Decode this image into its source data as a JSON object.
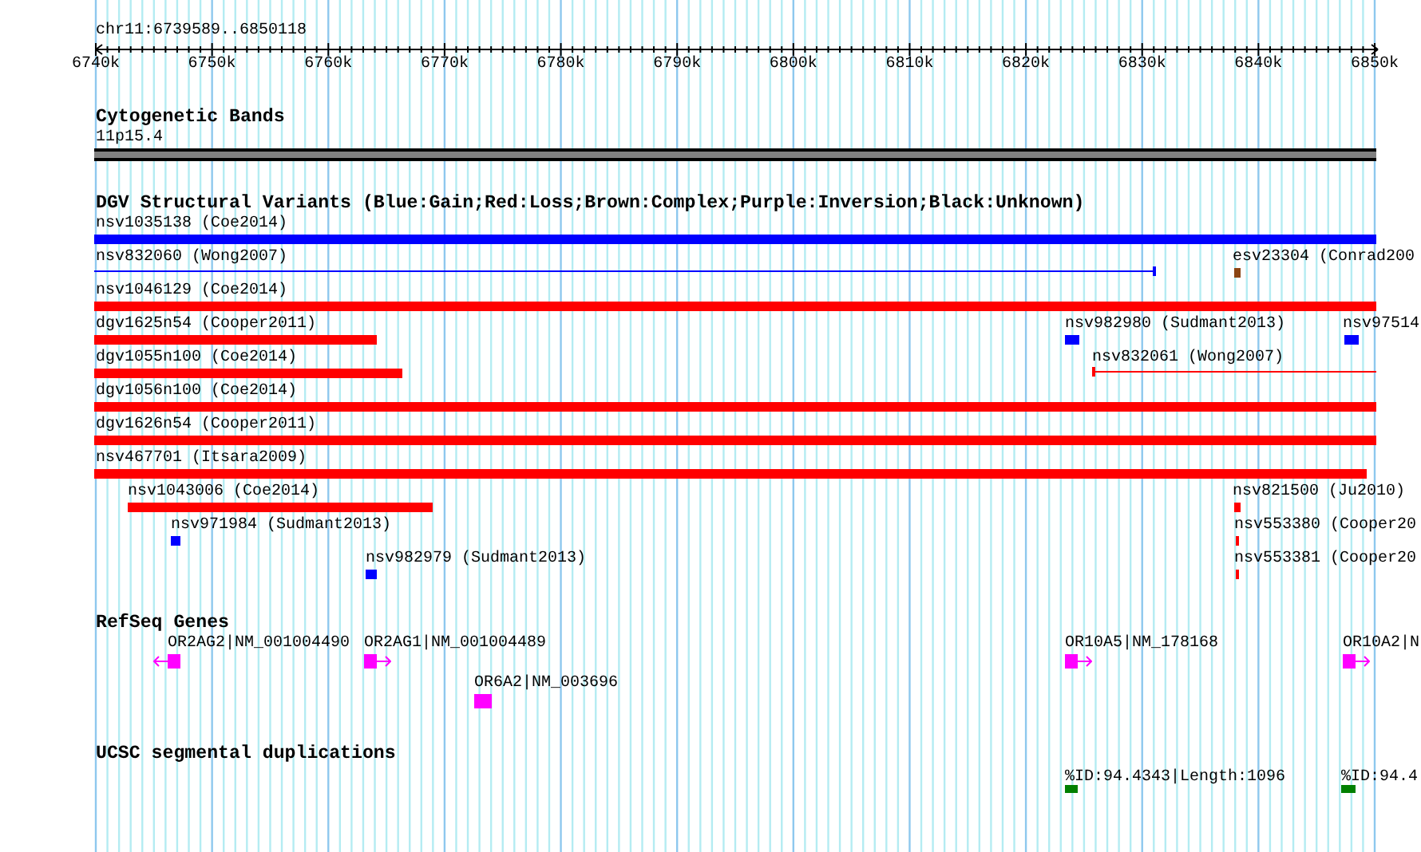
{
  "ruler": {
    "title": "chr11:6739589..6850118",
    "ticks": [
      "6740k",
      "6750k",
      "6760k",
      "6770k",
      "6780k",
      "6790k",
      "6800k",
      "6810k",
      "6820k",
      "6830k",
      "6840k",
      "6850k"
    ]
  },
  "tracks": [
    {
      "title": "Cytogenetic Bands",
      "features": [
        {
          "kind": "band",
          "label": "11p15.4",
          "color": "#808080"
        }
      ]
    },
    {
      "title": "DGV Structural Variants (Blue:Gain;Red:Loss;Brown:Complex;Purple:Inversion;Black:Unknown)",
      "features": [
        {
          "kind": "solid",
          "label": "nsv1035138 (Coe2014)",
          "color": "#0000ff"
        },
        {
          "kind": "line",
          "label": "nsv832060 (Wong2007)",
          "color": "#0000ff"
        },
        {
          "kind": "solid",
          "label": "esv23304 (Conrad200",
          "color": "#8b4513"
        },
        {
          "kind": "solid",
          "label": "nsv1046129 (Coe2014)",
          "color": "#ff0000"
        },
        {
          "kind": "solid",
          "label": "dgv1625n54 (Cooper2011)",
          "color": "#ff0000"
        },
        {
          "kind": "solid",
          "label": "nsv982980 (Sudmant2013)",
          "color": "#0000ff"
        },
        {
          "kind": "solid",
          "label": "nsv97514",
          "color": "#0000ff"
        },
        {
          "kind": "solid",
          "label": "dgv1055n100 (Coe2014)",
          "color": "#ff0000"
        },
        {
          "kind": "line",
          "label": "nsv832061 (Wong2007)",
          "color": "#ff0000"
        },
        {
          "kind": "solid",
          "label": "dgv1056n100 (Coe2014)",
          "color": "#ff0000"
        },
        {
          "kind": "solid",
          "label": "dgv1626n54 (Cooper2011)",
          "color": "#ff0000"
        },
        {
          "kind": "solid",
          "label": "nsv467701 (Itsara2009)",
          "color": "#ff0000"
        },
        {
          "kind": "solid",
          "label": "nsv1043006 (Coe2014)",
          "color": "#ff0000"
        },
        {
          "kind": "solid",
          "label": "nsv821500 (Ju2010)",
          "color": "#ff0000"
        },
        {
          "kind": "solid",
          "label": "nsv971984 (Sudmant2013)",
          "color": "#0000ff"
        },
        {
          "kind": "solid",
          "label": "nsv553380 (Cooper20",
          "color": "#ff0000"
        },
        {
          "kind": "solid",
          "label": "nsv982979 (Sudmant2013)",
          "color": "#0000ff"
        },
        {
          "kind": "solid",
          "label": "nsv553381 (Cooper20",
          "color": "#ff0000"
        }
      ]
    },
    {
      "title": "RefSeq Genes",
      "features": [
        {
          "kind": "reverse",
          "label": "OR2AG2|NM_001004490",
          "color": "#ff00ff"
        },
        {
          "kind": "forward",
          "label": "OR2AG1|NM_001004489",
          "color": "#ff00ff"
        },
        {
          "kind": "plain",
          "label": "OR6A2|NM_003696",
          "color": "#ff00ff"
        },
        {
          "kind": "forward",
          "label": "OR10A5|NM_178168",
          "color": "#ff00ff"
        },
        {
          "kind": "forward",
          "label": "OR10A2|N",
          "color": "#ff00ff"
        }
      ]
    },
    {
      "title": "UCSC segmental duplications",
      "features": [
        {
          "kind": "solid",
          "label": "%ID:94.4343|Length:1096",
          "color": "#008000"
        },
        {
          "kind": "solid",
          "label": "%ID:94.4",
          "color": "#008000"
        }
      ]
    }
  ]
}
